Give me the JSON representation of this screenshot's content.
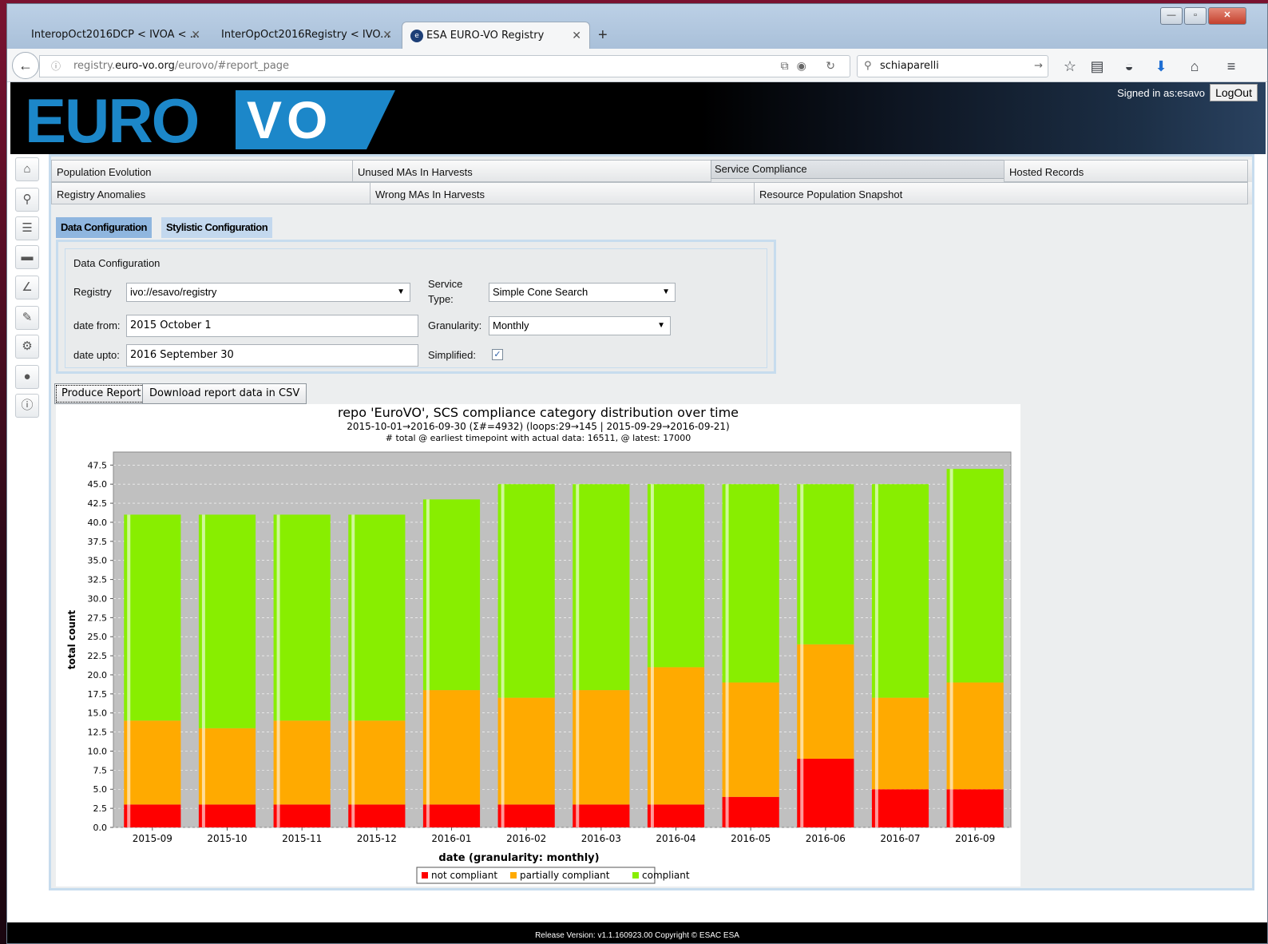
{
  "browser": {
    "tabs": [
      {
        "label": "InteropOct2016DCP < IVOA < ..."
      },
      {
        "label": "InterOpOct2016Registry < IVO..."
      },
      {
        "label": "ESA EURO-VO Registry"
      }
    ],
    "url": {
      "prefix": "registry.",
      "domain": "euro-vo.org",
      "path": "/eurovo/#report_page"
    },
    "search_value": "schiaparelli"
  },
  "banner": {
    "logo_left": "EURO",
    "logo_right": "VO",
    "signed_in": "Signed in as:esavo",
    "logout": "LogOut"
  },
  "menu": {
    "row1": [
      "Population Evolution",
      "Unused MAs In Harvests",
      "Service Compliance",
      "Hosted Records"
    ],
    "row2": [
      "Registry Anomalies",
      "Wrong MAs In Harvests",
      "Resource Population Snapshot"
    ]
  },
  "config_tabs": [
    "Data Configuration",
    "Stylistic Configuration"
  ],
  "config": {
    "legend": "Data Configuration",
    "registry_label": "Registry",
    "registry_value": "ivo://esavo/registry",
    "service_type_label_1": "Service",
    "service_type_label_2": "Type:",
    "service_type_value": "Simple Cone Search",
    "date_from_label": "date from:",
    "date_from_value": "2015 October 1",
    "granularity_label": "Granularity:",
    "granularity_value": "Monthly",
    "date_upto_label": "date upto:",
    "date_upto_value": "2016 September 30",
    "simplified_label": "Simplified:",
    "simplified_checked": true
  },
  "actions": {
    "produce": "Produce Report",
    "download": "Download report data in CSV"
  },
  "footer": "Release Version: v1.1.160923.00 Copyright © ESAC ESA",
  "chart_data": {
    "type": "bar",
    "stacked": true,
    "title": "repo 'EuroVO', SCS compliance category distribution over time",
    "subtitle1": "2015-10-01→2016-09-30 (Σ#=4932) (loops:29→145 | 2015-09-29→2016-09-21)",
    "subtitle2": "# total @ earliest timepoint with actual data: 16511, @ latest: 17000",
    "xlabel": "date (granularity: monthly)",
    "ylabel": "total count",
    "ylim": [
      0,
      47.5
    ],
    "yticks": [
      0.0,
      2.5,
      5.0,
      7.5,
      10.0,
      12.5,
      15.0,
      17.5,
      20.0,
      22.5,
      25.0,
      27.5,
      30.0,
      32.5,
      35.0,
      37.5,
      40.0,
      42.5,
      45.0,
      47.5
    ],
    "grid": true,
    "legend_position": "bottom",
    "categories": [
      "2015-09",
      "2015-10",
      "2015-11",
      "2015-12",
      "2016-01",
      "2016-02",
      "2016-03",
      "2016-04",
      "2016-05",
      "2016-06",
      "2016-07",
      "2016-09"
    ],
    "series": [
      {
        "name": "not compliant",
        "color": "#ff0000",
        "values": [
          3,
          3,
          3,
          3,
          3,
          3,
          3,
          3,
          4,
          9,
          5,
          5
        ]
      },
      {
        "name": "partially compliant",
        "color": "#ffaa00",
        "values": [
          11,
          10,
          11,
          11,
          15,
          14,
          15,
          18,
          15,
          15,
          12,
          14
        ]
      },
      {
        "name": "compliant",
        "color": "#88ee00",
        "values": [
          27,
          28,
          27,
          27,
          25,
          28,
          27,
          24,
          26,
          21,
          28,
          28
        ]
      }
    ]
  }
}
